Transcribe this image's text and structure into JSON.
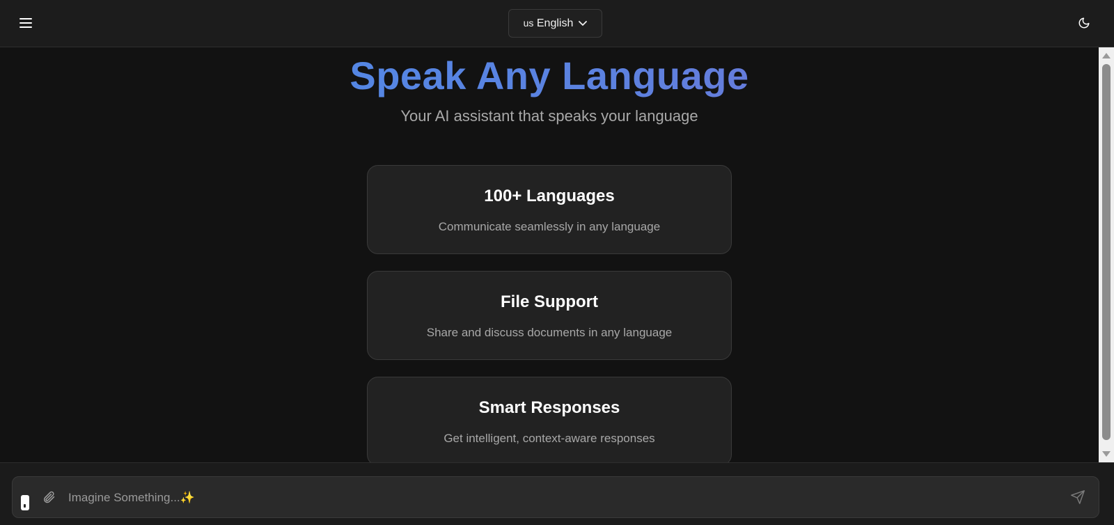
{
  "header": {
    "menu_icon": "hamburger-menu-icon",
    "language": {
      "flag": "us",
      "label": "English",
      "chevron_icon": "chevron-down-icon"
    },
    "theme_icon": "moon-icon"
  },
  "hero": {
    "title": "Speak Any Language",
    "subtitle": "Your AI assistant that speaks your language",
    "title_gradient": [
      "#4a8ce8",
      "#7b6fd0"
    ]
  },
  "features": [
    {
      "title": "100+ Languages",
      "description": "Communicate seamlessly in any language"
    },
    {
      "title": "File Support",
      "description": "Share and discuss documents in any language"
    },
    {
      "title": "Smart Responses",
      "description": "Get intelligent, context-aware responses"
    }
  ],
  "composer": {
    "placeholder": "Imagine Something...✨",
    "mic_icon": "microphone-icon",
    "attach_icon": "paperclip-icon",
    "send_icon": "send-icon"
  },
  "colors": {
    "background": "#121212",
    "header": "#1c1c1c",
    "card": "#222222",
    "input": "#2a2a2a"
  }
}
